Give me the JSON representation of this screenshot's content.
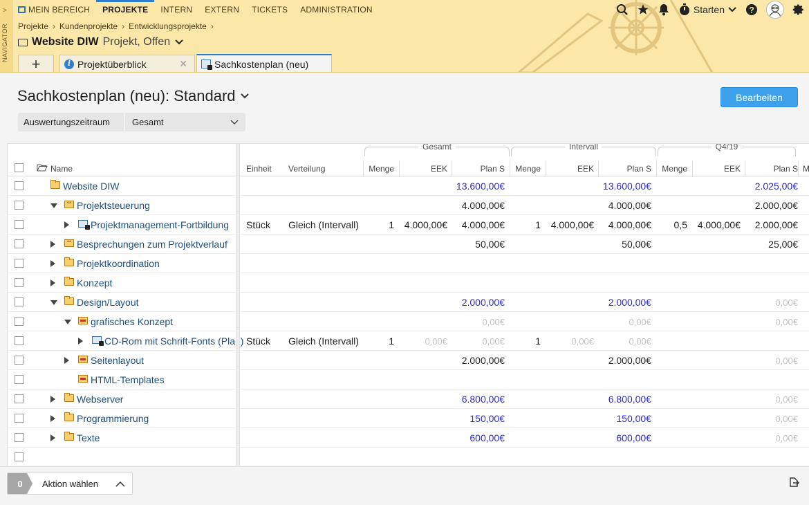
{
  "navigator_label": "NAVIGATOR",
  "topnav": [
    {
      "label": "MEIN BEREICH",
      "active": false
    },
    {
      "label": "PROJEKTE",
      "active": true
    },
    {
      "label": "INTERN",
      "active": false
    },
    {
      "label": "EXTERN",
      "active": false
    },
    {
      "label": "TICKETS",
      "active": false
    },
    {
      "label": "ADMINISTRATION",
      "active": false
    }
  ],
  "topright": {
    "starten_label": "Starten"
  },
  "breadcrumb": [
    "Projekte",
    "Kundenprojekte",
    "Entwicklungsprojekte"
  ],
  "project": {
    "name": "Website DIW",
    "status": "Projekt, Offen"
  },
  "tabs": [
    {
      "label": "Projektüberblick",
      "icon": "info-icon"
    },
    {
      "label": "Sachkostenplan (neu)",
      "icon": "cost-plan-icon",
      "active": true
    }
  ],
  "page": {
    "title": "Sachkostenplan (neu): Standard",
    "edit_button": "Bearbeiten",
    "filter_label": "Auswertungszeitraum",
    "filter_value": "Gesamt"
  },
  "table": {
    "columns": {
      "name": "Name",
      "einheit": "Einheit",
      "verteilung": "Verteilung",
      "menge": "Menge",
      "eek": "EEK",
      "plan": "Plan S",
      "m_cut": "M"
    },
    "groups": [
      "Gesamt",
      "Intervall",
      "Q4/19"
    ],
    "rows": [
      {
        "name": "Website DIW",
        "icon": "folder",
        "level": 0,
        "toggle": "none",
        "einheit": "",
        "verteilung": "",
        "g": [
          "",
          "",
          "13.600,00€"
        ],
        "i": [
          "",
          "",
          "13.600,00€"
        ],
        "q": [
          "",
          "",
          "2.025,00€"
        ],
        "plan_style": "blue",
        "q_style": "blue"
      },
      {
        "name": "Projektsteuerung",
        "icon": "meet",
        "level": 1,
        "toggle": "down",
        "einheit": "",
        "verteilung": "",
        "g": [
          "",
          "",
          "4.000,00€"
        ],
        "i": [
          "",
          "",
          "4.000,00€"
        ],
        "q": [
          "",
          "",
          "2.000,00€"
        ],
        "plan_style": "black",
        "q_style": "black"
      },
      {
        "name": "Projektmanagement-Fortbildung",
        "icon": "task",
        "level": 2,
        "toggle": "right",
        "einheit": "Stück",
        "verteilung": "Gleich (Intervall)",
        "g": [
          "1",
          "4.000,00€",
          "4.000,00€"
        ],
        "i": [
          "1",
          "4.000,00€",
          "4.000,00€"
        ],
        "q": [
          "0,5",
          "4.000,00€",
          "2.000,00€"
        ],
        "plan_style": "black",
        "q_style": "black"
      },
      {
        "name": "Besprechungen zum Projektverlauf",
        "icon": "meet",
        "level": 1,
        "toggle": "right",
        "einheit": "",
        "verteilung": "",
        "g": [
          "",
          "",
          "50,00€"
        ],
        "i": [
          "",
          "",
          "50,00€"
        ],
        "q": [
          "",
          "",
          "25,00€"
        ],
        "plan_style": "black",
        "q_style": "black"
      },
      {
        "name": "Projektkoordination",
        "icon": "folder",
        "level": 1,
        "toggle": "right",
        "einheit": "",
        "verteilung": "",
        "g": [
          "",
          "",
          ""
        ],
        "i": [
          "",
          "",
          ""
        ],
        "q": [
          "",
          "",
          ""
        ],
        "plan_style": "black",
        "q_style": "black"
      },
      {
        "name": "Konzept",
        "icon": "folder",
        "level": 1,
        "toggle": "right",
        "einheit": "",
        "verteilung": "",
        "g": [
          "",
          "",
          ""
        ],
        "i": [
          "",
          "",
          ""
        ],
        "q": [
          "",
          "",
          ""
        ],
        "plan_style": "black",
        "q_style": "black"
      },
      {
        "name": "Design/Layout",
        "icon": "folder",
        "level": 1,
        "toggle": "down",
        "einheit": "",
        "verteilung": "",
        "g": [
          "",
          "",
          "2.000,00€"
        ],
        "i": [
          "",
          "",
          "2.000,00€"
        ],
        "q": [
          "",
          "",
          "0,00€"
        ],
        "plan_style": "blue",
        "q_style": "grey"
      },
      {
        "name": "grafisches Konzept",
        "icon": "pkg",
        "level": 2,
        "toggle": "down",
        "einheit": "",
        "verteilung": "",
        "g": [
          "",
          "",
          "0,00€"
        ],
        "i": [
          "",
          "",
          "0,00€"
        ],
        "q": [
          "",
          "",
          "0,00€"
        ],
        "plan_style": "grey",
        "q_style": "grey"
      },
      {
        "name": "CD-Rom mit Schrift-Fonts (Plan)",
        "icon": "task",
        "level": 3,
        "toggle": "right",
        "einheit": "Stück",
        "verteilung": "Gleich (Intervall)",
        "g": [
          "1",
          "0,00€",
          "0,00€"
        ],
        "i": [
          "1",
          "0,00€",
          "0,00€"
        ],
        "q": [
          "",
          "",
          ""
        ],
        "plan_style": "grey",
        "q_style": "grey",
        "eek_grey": true
      },
      {
        "name": "Seitenlayout",
        "icon": "pkg",
        "level": 2,
        "toggle": "right",
        "einheit": "",
        "verteilung": "",
        "g": [
          "",
          "",
          "2.000,00€"
        ],
        "i": [
          "",
          "",
          "2.000,00€"
        ],
        "q": [
          "",
          "",
          "0,00€"
        ],
        "plan_style": "black",
        "q_style": "grey"
      },
      {
        "name": "HTML-Templates",
        "icon": "pkg",
        "level": 2,
        "toggle": "none",
        "einheit": "",
        "verteilung": "",
        "g": [
          "",
          "",
          ""
        ],
        "i": [
          "",
          "",
          ""
        ],
        "q": [
          "",
          "",
          ""
        ],
        "plan_style": "black",
        "q_style": "black"
      },
      {
        "name": "Webserver",
        "icon": "folder",
        "level": 1,
        "toggle": "right",
        "einheit": "",
        "verteilung": "",
        "g": [
          "",
          "",
          "6.800,00€"
        ],
        "i": [
          "",
          "",
          "6.800,00€"
        ],
        "q": [
          "",
          "",
          "0,00€"
        ],
        "plan_style": "blue",
        "q_style": "grey"
      },
      {
        "name": "Programmierung",
        "icon": "folder",
        "level": 1,
        "toggle": "right",
        "einheit": "",
        "verteilung": "",
        "g": [
          "",
          "",
          "150,00€"
        ],
        "i": [
          "",
          "",
          "150,00€"
        ],
        "q": [
          "",
          "",
          "0,00€"
        ],
        "plan_style": "blue",
        "q_style": "grey"
      },
      {
        "name": "Texte",
        "icon": "folder",
        "level": 1,
        "toggle": "right",
        "einheit": "",
        "verteilung": "",
        "g": [
          "",
          "",
          "600,00€"
        ],
        "i": [
          "",
          "",
          "600,00€"
        ],
        "q": [
          "",
          "",
          "0,00€"
        ],
        "plan_style": "blue",
        "q_style": "grey"
      }
    ]
  },
  "bottom": {
    "selected_count": "0",
    "action_label": "Aktion wählen"
  }
}
